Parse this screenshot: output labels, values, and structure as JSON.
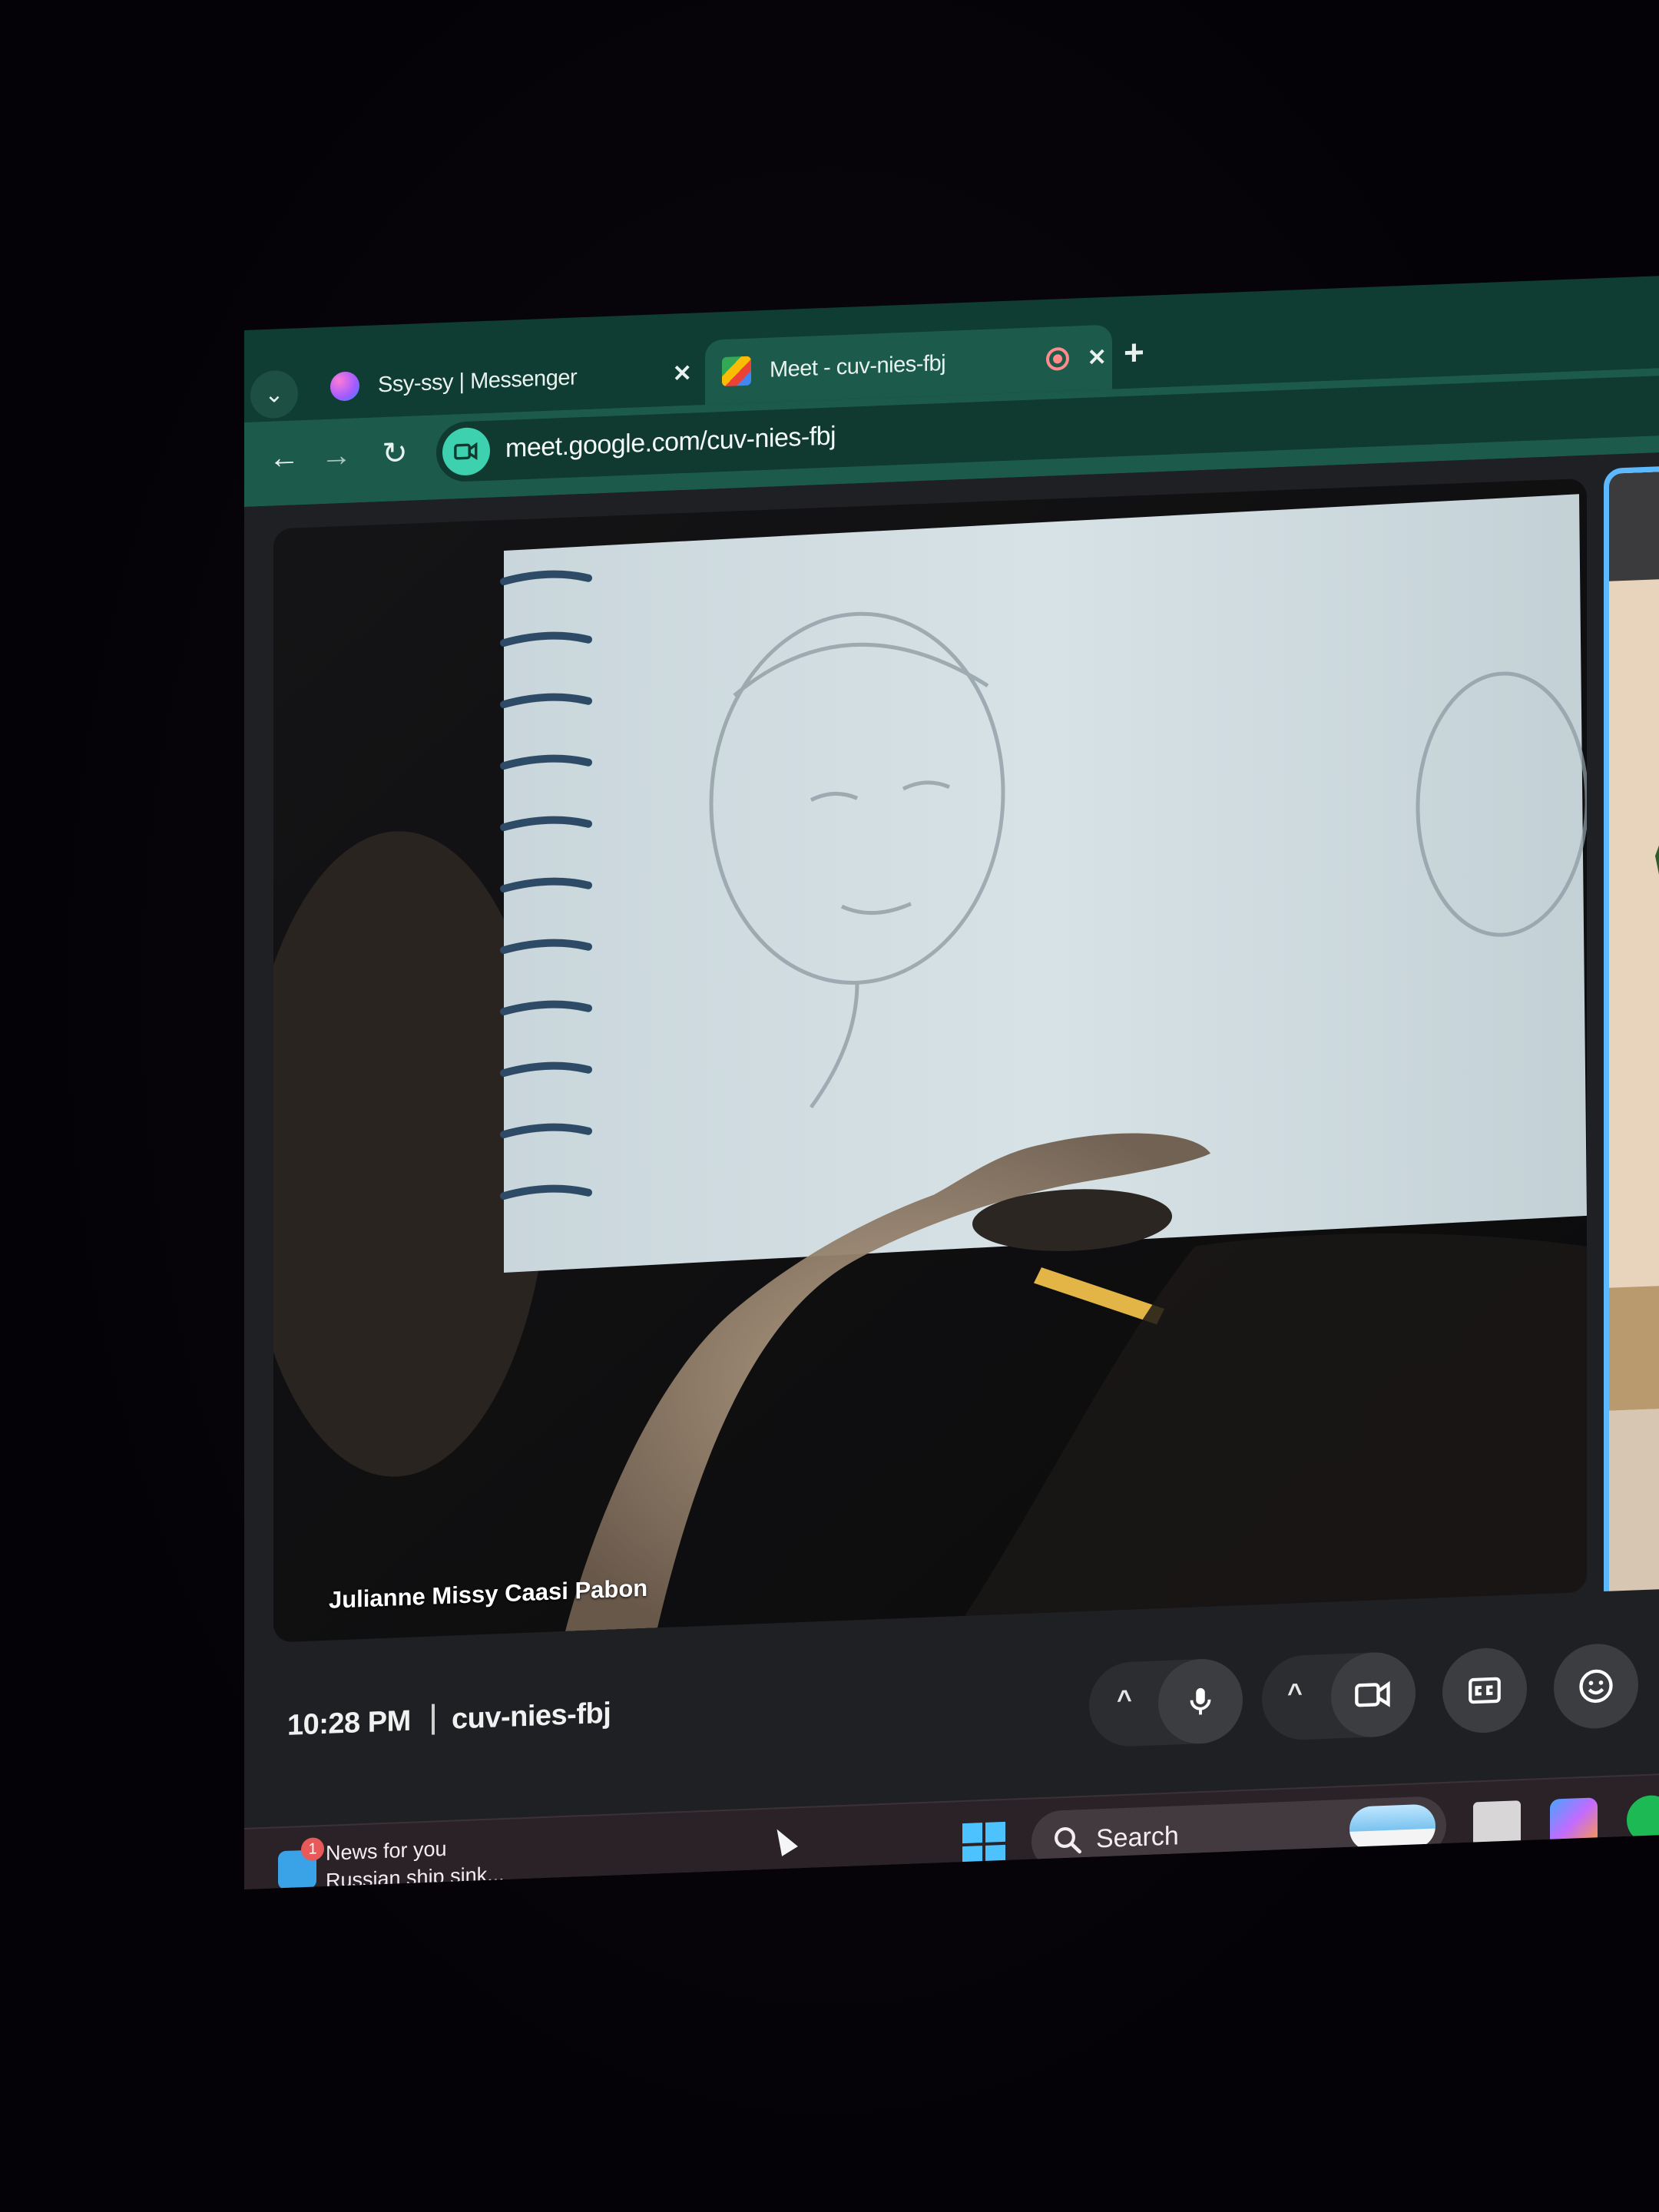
{
  "browser": {
    "tabs": [
      {
        "title": "Ssy-ssy | Messenger",
        "icon": "messenger-icon",
        "active": false
      },
      {
        "title": "Meet - cuv-nies-fbj",
        "icon": "google-meet-icon",
        "active": true,
        "recording_indicator": true
      }
    ],
    "url": "meet.google.com/cuv-nies-fbj"
  },
  "meet": {
    "main_participant_name": "Julianne Missy Caasi Pabon",
    "time": "10:28 PM",
    "meeting_code": "cuv-nies-fbj",
    "controls": [
      "mic-options-caret",
      "mic-icon",
      "camera-options-caret",
      "camera-icon",
      "captions-icon",
      "emoji-reaction-icon"
    ],
    "side_tile_highlight_color": "#5cb8ff"
  },
  "taskbar": {
    "news_badge_count": "1",
    "news_title": "News for you",
    "news_headline": "Russian ship sink...",
    "search_label": "Search"
  }
}
